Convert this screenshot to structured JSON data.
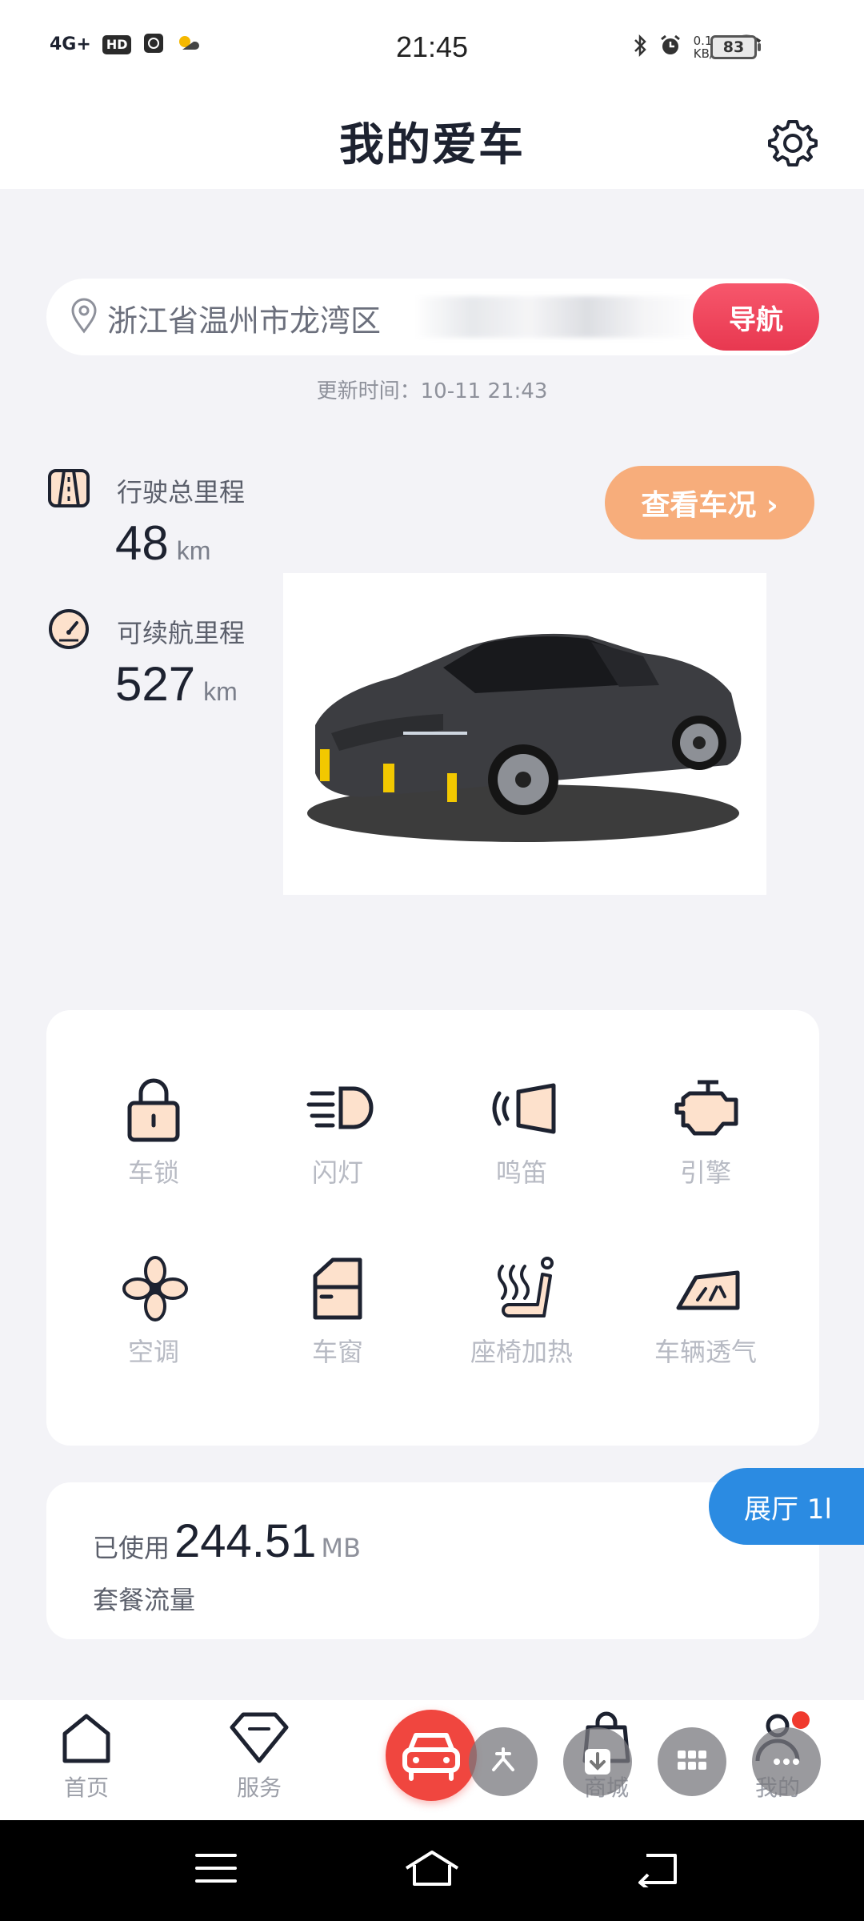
{
  "status_bar": {
    "network": "4G+",
    "hd": "HD",
    "time": "21:45",
    "speed_value": "0.10",
    "speed_unit": "KB/s",
    "battery": "83"
  },
  "header": {
    "title": "我的爱车"
  },
  "location": {
    "address": "浙江省温州市龙湾区",
    "nav_label": "导航",
    "update_time": "更新时间：10-11 21:43"
  },
  "stats": {
    "total_mileage": {
      "label": "行驶总里程",
      "value": "48",
      "unit": "km"
    },
    "range": {
      "label": "可续航里程",
      "value": "527",
      "unit": "km"
    }
  },
  "check_status_label": "查看车况 ›",
  "controls": [
    {
      "label": "车锁",
      "icon": "lock-icon"
    },
    {
      "label": "闪灯",
      "icon": "headlight-icon"
    },
    {
      "label": "鸣笛",
      "icon": "horn-icon"
    },
    {
      "label": "引擎",
      "icon": "engine-icon"
    },
    {
      "label": "空调",
      "icon": "fan-icon"
    },
    {
      "label": "车窗",
      "icon": "window-icon"
    },
    {
      "label": "座椅加热",
      "icon": "seat-heat-icon"
    },
    {
      "label": "车辆透气",
      "icon": "vent-icon"
    }
  ],
  "data_usage": {
    "prefix": "已使用",
    "value": "244.51",
    "unit": "MB",
    "caption": "套餐流量"
  },
  "showroom_label": "展厅 1l",
  "bottom_nav": {
    "home": "首页",
    "service": "服务",
    "mall": "商城",
    "mine": "我的"
  },
  "colors": {
    "accent_red": "#e83850",
    "accent_orange": "#f7ad7b",
    "showroom_blue": "#2b8be2",
    "icon_fill": "#fde1cc"
  }
}
